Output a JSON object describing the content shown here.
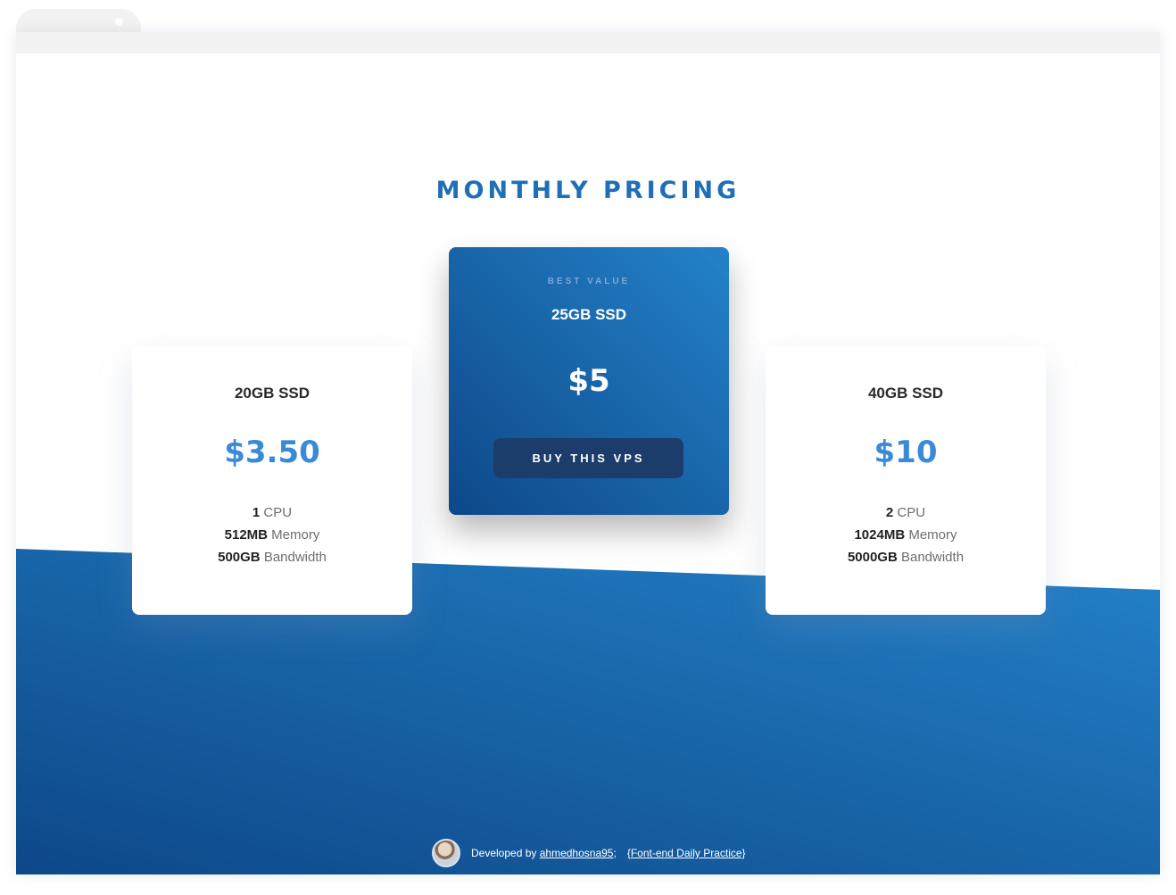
{
  "page": {
    "title": "MONTHLY PRICING",
    "brand_color": "#1f6fb8",
    "accent_color": "#3a8ad8",
    "gradient_colors": [
      "#2482c9",
      "#0d4889"
    ]
  },
  "plans": [
    {
      "name": "20GB SSD",
      "price": "$3.50",
      "features": [
        {
          "value": "1",
          "label": "CPU"
        },
        {
          "value": "512MB",
          "label": "Memory"
        },
        {
          "value": "500GB",
          "label": "Bandwidth"
        }
      ]
    },
    {
      "badge": "BEST VALUE",
      "name": "25GB SSD",
      "price": "$5",
      "button_label": "BUY THIS VPS"
    },
    {
      "name": "40GB SSD",
      "price": "$10",
      "features": [
        {
          "value": "2",
          "label": "CPU"
        },
        {
          "value": "1024MB",
          "label": "Memory"
        },
        {
          "value": "5000GB",
          "label": "Bandwidth"
        }
      ]
    }
  ],
  "footer": {
    "prefix": "Developed by",
    "author_link": "ahmedhosna95",
    "separator": ";",
    "project_link": "{Font-end Daily Practice}"
  }
}
